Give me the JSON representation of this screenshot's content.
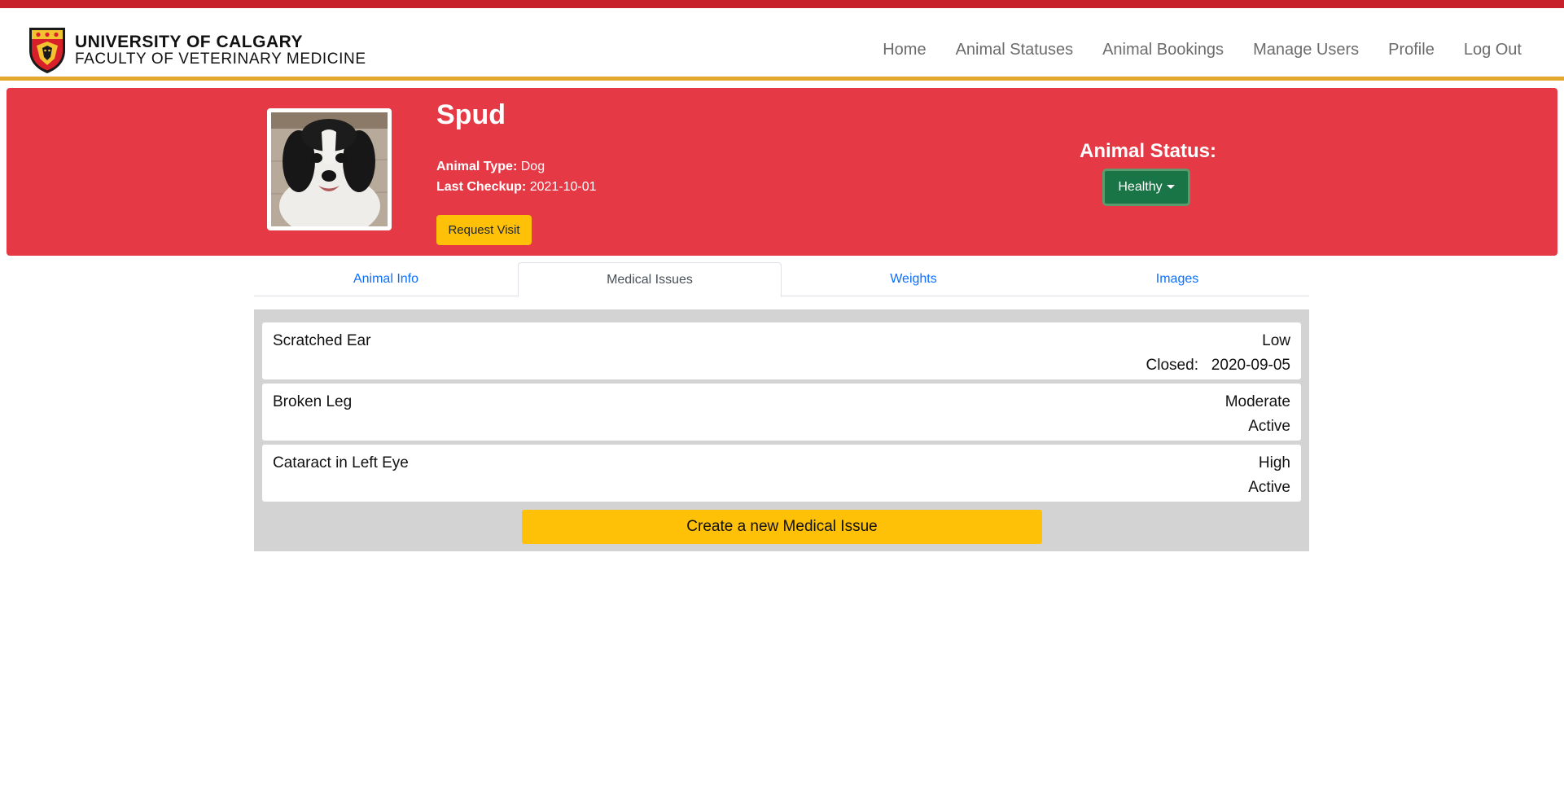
{
  "brand": {
    "line1": "UNIVERSITY OF CALGARY",
    "line2": "FACULTY OF VETERINARY MEDICINE",
    "logo_icon": "university-crest-icon"
  },
  "nav": {
    "items": [
      {
        "label": "Home"
      },
      {
        "label": "Animal Statuses"
      },
      {
        "label": "Animal Bookings"
      },
      {
        "label": "Manage Users"
      },
      {
        "label": "Profile"
      },
      {
        "label": "Log Out"
      }
    ]
  },
  "animal": {
    "name": "Spud",
    "photo": "dog-photo",
    "type_label": "Animal Type:",
    "type_value": "Dog",
    "checkup_label": "Last Checkup:",
    "checkup_value": "2021-10-01",
    "request_visit_label": "Request Visit",
    "status_heading": "Animal Status:",
    "status_value": "Healthy"
  },
  "tabs": [
    {
      "label": "Animal Info",
      "active": false
    },
    {
      "label": "Medical Issues",
      "active": true
    },
    {
      "label": "Weights",
      "active": false
    },
    {
      "label": "Images",
      "active": false
    }
  ],
  "medical_issues": [
    {
      "title": "Scratched Ear",
      "severity": "Low",
      "state": "Closed:   2020-09-05"
    },
    {
      "title": "Broken Leg",
      "severity": "Moderate",
      "state": "Active"
    },
    {
      "title": "Cataract in Left Eye",
      "severity": "High",
      "state": "Active"
    }
  ],
  "create_issue_label": "Create a new Medical Issue",
  "colors": {
    "top_strip": "#c8202b",
    "gold_rule": "#e4a92c",
    "hero_red": "#e63946",
    "accent_yellow": "#ffc107",
    "status_green": "#197446",
    "panel_gray": "#d3d3d3",
    "tab_link": "#0d6efd"
  }
}
